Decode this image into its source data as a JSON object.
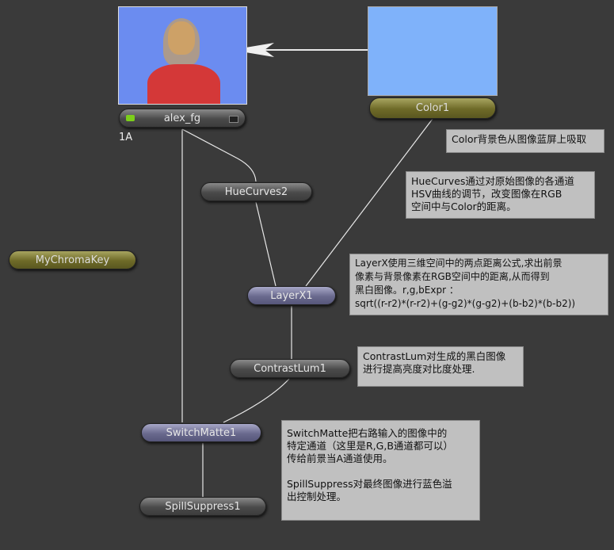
{
  "colors": {
    "swatch": "#7fb2fa",
    "bg": "#3a3a3a"
  },
  "nodes": {
    "alex_fg": "alex_fg",
    "alex_fg_label": "1A",
    "color1": "Color1",
    "huecurves": "HueCurves2",
    "mychromakey": "MyChromaKey",
    "layerx": "LayerX1",
    "contrastlum": "ContrastLum1",
    "switchmatte": "SwitchMatte1",
    "spillsuppress": "SpillSuppress1"
  },
  "notes": {
    "color": "Color背景色从图像蓝屏上吸取",
    "huecurves": "HueCurves通过对原始图像的各通道\nHSV曲线的调节，改变图像在RGB\n空间中与Color的距离。",
    "layerx": "LayerX使用三维空间中的两点距离公式,求出前景\n像素与背景像素在RGB空间中的距离,从而得到\n黑白图像。r,g,bExpr ：\nsqrt((r-r2)*(r-r2)+(g-g2)*(g-g2)+(b-b2)*(b-b2))",
    "contrastlum": "ContrastLum对生成的黑白图像\n进行提高亮度对比度处理.",
    "switchmatte": "SwitchMatte把右路输入的图像中的\n特定通道（这里是R,G,B通道都可以）\n传给前景当A通道使用。\n\nSpillSuppress对最终图像进行蓝色溢\n出控制处理。"
  }
}
